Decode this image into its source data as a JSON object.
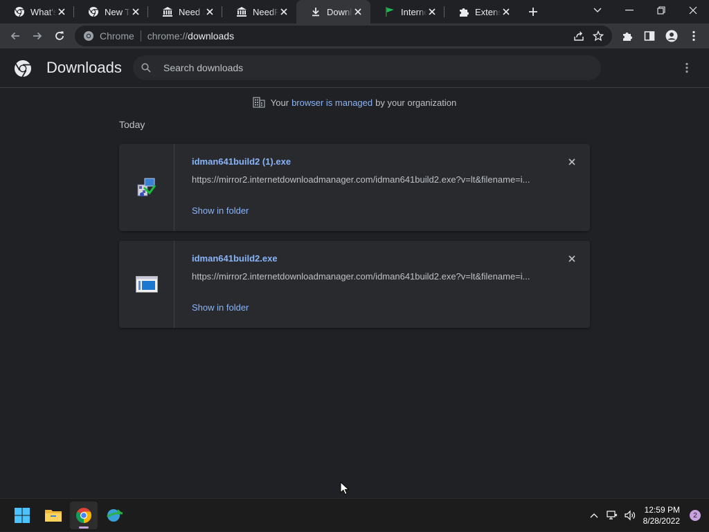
{
  "tabs": [
    {
      "label": "What's New",
      "icon": "chrome-icon",
      "active": false
    },
    {
      "label": "New Tab",
      "icon": "chrome-icon",
      "active": false
    },
    {
      "label": "Need For",
      "icon": "bank-icon",
      "active": false
    },
    {
      "label": "NeedFor",
      "icon": "bank-icon",
      "active": false
    },
    {
      "label": "Downloads",
      "icon": "download-icon",
      "active": true
    },
    {
      "label": "Internet",
      "icon": "flag-icon",
      "active": false
    },
    {
      "label": "Extensions",
      "icon": "puzzle-icon",
      "active": false
    }
  ],
  "omnibox": {
    "chip": "Chrome",
    "scheme": "chrome://",
    "host": "downloads"
  },
  "page": {
    "title": "Downloads",
    "search_placeholder": "Search downloads",
    "managed_prefix": "Your",
    "managed_link": "browser is managed",
    "managed_suffix": "by your organization",
    "section": "Today"
  },
  "downloads": [
    {
      "name": "idman641build2 (1).exe",
      "url": "https://mirror2.internetdownloadmanager.com/idman641build2.exe?v=lt&filename=i...",
      "action": "Show in folder",
      "icon": "installer-icon"
    },
    {
      "name": "idman641build2.exe",
      "url": "https://mirror2.internetdownloadmanager.com/idman641build2.exe?v=lt&filename=i...",
      "action": "Show in folder",
      "icon": "exe-file-icon"
    }
  ],
  "taskbar": {
    "time": "12:59 PM",
    "date": "8/28/2022",
    "notifications": "2"
  },
  "colors": {
    "accent": "#8ab4f8",
    "background": "#202124",
    "card": "#292a2d"
  }
}
